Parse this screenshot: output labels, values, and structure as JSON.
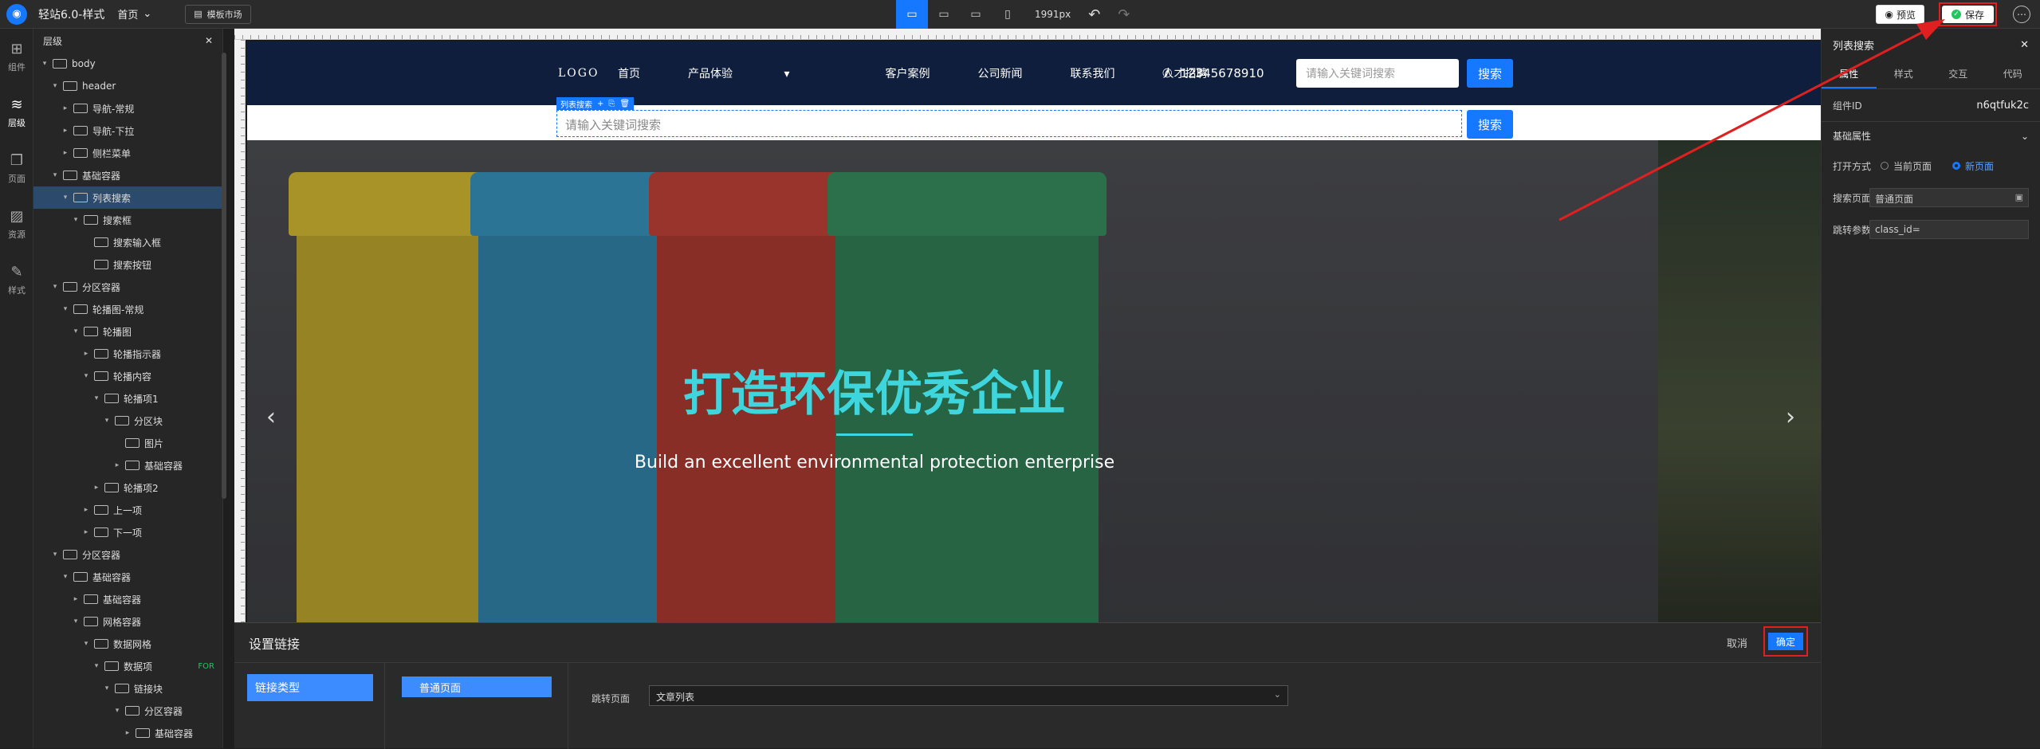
{
  "topbar": {
    "app_title": "轻站6.0-样式",
    "page_select": "首页",
    "market_label": "模板市场",
    "width_label": "1991px",
    "preview_label": "预览",
    "save_label": "保存"
  },
  "rail": [
    {
      "label": "组件",
      "icon": "grid-icon"
    },
    {
      "label": "层级",
      "icon": "layers-icon"
    },
    {
      "label": "页面",
      "icon": "page-icon"
    },
    {
      "label": "资源",
      "icon": "image-icon"
    },
    {
      "label": "样式",
      "icon": "brush-icon"
    }
  ],
  "layers": {
    "title": "层级",
    "items": [
      {
        "label": "body",
        "indent": 0,
        "open": true
      },
      {
        "label": "header",
        "indent": 1,
        "open": true
      },
      {
        "label": "导航-常规",
        "indent": 2,
        "open": false
      },
      {
        "label": "导航-下拉",
        "indent": 2,
        "open": false
      },
      {
        "label": "侧栏菜单",
        "indent": 2,
        "open": false
      },
      {
        "label": "基础容器",
        "indent": 1,
        "open": true
      },
      {
        "label": "列表搜索",
        "indent": 2,
        "open": true,
        "selected": true
      },
      {
        "label": "搜索框",
        "indent": 3,
        "open": true
      },
      {
        "label": "搜索输入框",
        "indent": 4,
        "open": null
      },
      {
        "label": "搜索按钮",
        "indent": 4,
        "open": null
      },
      {
        "label": "分区容器",
        "indent": 1,
        "open": true
      },
      {
        "label": "轮播图-常规",
        "indent": 2,
        "open": true
      },
      {
        "label": "轮播图",
        "indent": 3,
        "open": true
      },
      {
        "label": "轮播指示器",
        "indent": 4,
        "open": false
      },
      {
        "label": "轮播内容",
        "indent": 4,
        "open": true
      },
      {
        "label": "轮播项1",
        "indent": 5,
        "open": true
      },
      {
        "label": "分区块",
        "indent": 6,
        "open": true
      },
      {
        "label": "图片",
        "indent": 7,
        "open": null
      },
      {
        "label": "基础容器",
        "indent": 7,
        "open": false
      },
      {
        "label": "轮播项2",
        "indent": 5,
        "open": false
      },
      {
        "label": "上一项",
        "indent": 4,
        "open": false
      },
      {
        "label": "下一项",
        "indent": 4,
        "open": false
      },
      {
        "label": "分区容器",
        "indent": 1,
        "open": true
      },
      {
        "label": "基础容器",
        "indent": 2,
        "open": true
      },
      {
        "label": "基础容器",
        "indent": 3,
        "open": false
      },
      {
        "label": "网格容器",
        "indent": 3,
        "open": true
      },
      {
        "label": "数据网格",
        "indent": 4,
        "open": true
      },
      {
        "label": "数据项",
        "indent": 5,
        "open": true,
        "tag": "FOR"
      },
      {
        "label": "链接块",
        "indent": 6,
        "open": true
      },
      {
        "label": "分区容器",
        "indent": 7,
        "open": true
      },
      {
        "label": "基础容器",
        "indent": 8,
        "open": false
      }
    ]
  },
  "site": {
    "logo": "LOGO",
    "nav": [
      "首页",
      "产品体验",
      "客户案例",
      "公司新闻",
      "联系我们",
      "人才招聘"
    ],
    "phone": "12345678910",
    "search_placeholder": "请输入关键词搜索",
    "search_button": "搜索",
    "selected_tag": "列表搜索",
    "list_search_placeholder": "请输入关键词搜索",
    "list_search_button": "搜索",
    "hero_title": "打造环保优秀企业",
    "hero_subtitle": "Build an excellent environmental protection enterprise",
    "bin_colors": [
      "#b8a12c",
      "#2f7fa3",
      "#a6392f",
      "#2f7a52"
    ]
  },
  "link_panel": {
    "title": "设置链接",
    "cancel": "取消",
    "ok": "确定",
    "left_item": "链接类型",
    "mid_item": "普通页面",
    "field_label": "跳转页面",
    "field_value": "文章列表"
  },
  "props": {
    "title": "列表搜索",
    "tabs": [
      "属性",
      "样式",
      "交互",
      "代码"
    ],
    "component_id_label": "组件ID",
    "component_id": "n6qtfuk2c",
    "section_basic": "基础属性",
    "open_mode_label": "打开方式",
    "open_current": "当前页面",
    "open_new": "新页面",
    "search_page_label": "搜索页面",
    "search_page_value": "普通页面",
    "jump_param_label": "跳转参数",
    "jump_param_value": "class_id="
  },
  "colors": {
    "accent": "#1677ff",
    "annotation": "#e02020",
    "hero_text": "#3ed6dc"
  }
}
